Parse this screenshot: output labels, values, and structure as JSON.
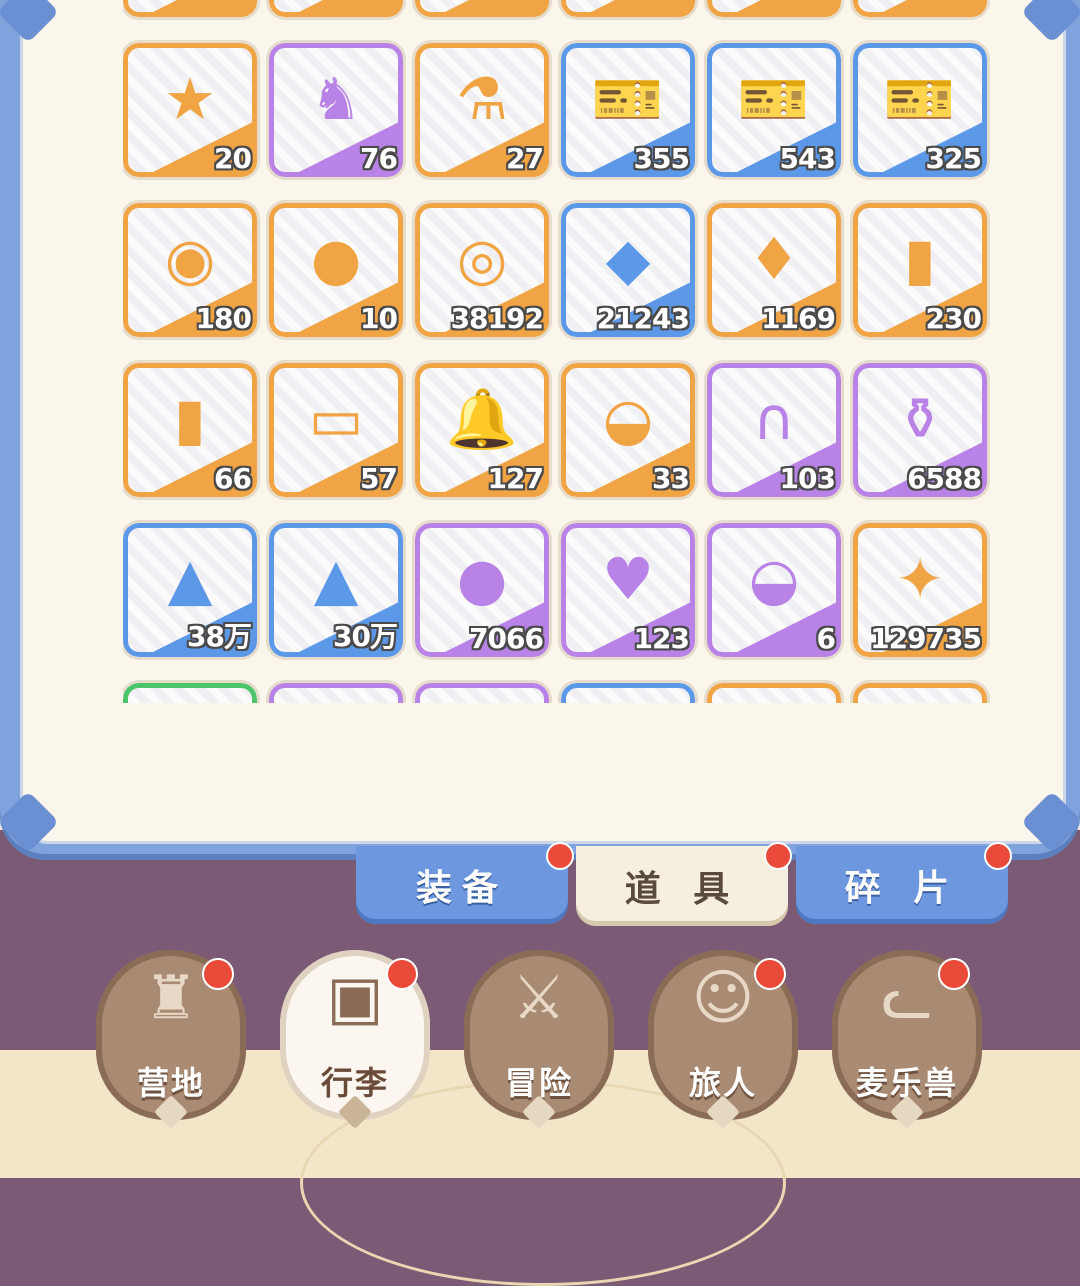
{
  "inventory": {
    "items": [
      {
        "name": "item-partial-1",
        "icon": "",
        "count": "",
        "rarity": "orange"
      },
      {
        "name": "item-partial-2",
        "icon": "",
        "count": "",
        "rarity": "orange"
      },
      {
        "name": "item-partial-3",
        "icon": "",
        "count": "",
        "rarity": "orange"
      },
      {
        "name": "item-partial-4",
        "icon": "",
        "count": "",
        "rarity": "orange"
      },
      {
        "name": "item-partial-5",
        "icon": "",
        "count": "",
        "rarity": "orange"
      },
      {
        "name": "item-partial-6",
        "icon": "",
        "count": "",
        "rarity": "orange"
      },
      {
        "name": "gold-crystal-ore",
        "icon": "gold-crystal-icon",
        "glyph": "★",
        "count": "20",
        "rarity": "orange"
      },
      {
        "name": "seahorse-figurine",
        "icon": "seahorse-icon",
        "glyph": "♞",
        "count": "76",
        "rarity": "purple"
      },
      {
        "name": "blue-potion",
        "icon": "potion-icon",
        "glyph": "⚗",
        "count": "27",
        "rarity": "orange"
      },
      {
        "name": "blue-ticket",
        "icon": "ticket-icon",
        "glyph": "🎫",
        "count": "355",
        "rarity": "blue"
      },
      {
        "name": "purple-ticket",
        "icon": "ticket-icon",
        "glyph": "🎫",
        "count": "543",
        "rarity": "blue"
      },
      {
        "name": "gold-ticket",
        "icon": "ticket-icon",
        "glyph": "🎫",
        "count": "325",
        "rarity": "blue"
      },
      {
        "name": "ornate-bell-ball",
        "icon": "bell-ball-icon",
        "glyph": "◉",
        "count": "180",
        "rarity": "orange"
      },
      {
        "name": "cat-coin",
        "icon": "cat-coin-icon",
        "glyph": "●",
        "count": "10",
        "rarity": "orange"
      },
      {
        "name": "rune-orb",
        "icon": "orb-icon",
        "glyph": "◎",
        "count": "38192",
        "rarity": "orange"
      },
      {
        "name": "blue-gem",
        "icon": "gem-icon",
        "glyph": "◆",
        "count": "21243",
        "rarity": "blue"
      },
      {
        "name": "ice-crystal",
        "icon": "crystal-icon",
        "glyph": "♦",
        "count": "1169",
        "rarity": "orange"
      },
      {
        "name": "rainbow-paint-tube",
        "icon": "paint-tube-icon",
        "glyph": "▮",
        "count": "230",
        "rarity": "orange"
      },
      {
        "name": "rainbow-paint-splash",
        "icon": "paint-bottle-icon",
        "glyph": "▮",
        "count": "66",
        "rarity": "orange"
      },
      {
        "name": "outfit-card",
        "icon": "card-icon",
        "glyph": "▭",
        "count": "57",
        "rarity": "orange"
      },
      {
        "name": "ribbon-bell",
        "icon": "bell-icon",
        "glyph": "🔔",
        "count": "127",
        "rarity": "orange"
      },
      {
        "name": "seed-sack",
        "icon": "sack-icon",
        "glyph": "◒",
        "count": "33",
        "rarity": "orange"
      },
      {
        "name": "golden-horseshoe",
        "icon": "horseshoe-icon",
        "glyph": "∩",
        "count": "103",
        "rarity": "purple"
      },
      {
        "name": "bottled-creature",
        "icon": "bottle-icon",
        "glyph": "⚱",
        "count": "6588",
        "rarity": "purple"
      },
      {
        "name": "blue-pearl-sand",
        "icon": "sand-pile-icon",
        "glyph": "▲",
        "count": "38万",
        "rarity": "blue"
      },
      {
        "name": "purple-pearl-sand",
        "icon": "sand-pile-icon",
        "glyph": "▲",
        "count": "30万",
        "rarity": "blue"
      },
      {
        "name": "paw-cookie",
        "icon": "cookie-icon",
        "glyph": "●",
        "count": "7066",
        "rarity": "purple"
      },
      {
        "name": "cat-spoon",
        "icon": "spoon-icon",
        "glyph": "♥",
        "count": "123",
        "rarity": "purple"
      },
      {
        "name": "paw-flour-sack",
        "icon": "flour-sack-icon",
        "glyph": "◒",
        "count": "6",
        "rarity": "purple"
      },
      {
        "name": "star-crystal",
        "icon": "star-crystal-icon",
        "glyph": "✦",
        "count": "129735",
        "rarity": "orange"
      },
      {
        "name": "item-partial-7",
        "icon": "",
        "count": "",
        "rarity": "green"
      },
      {
        "name": "item-partial-8",
        "icon": "",
        "count": "",
        "rarity": "purple"
      },
      {
        "name": "item-partial-9",
        "icon": "",
        "count": "",
        "rarity": "purple"
      },
      {
        "name": "item-partial-10",
        "icon": "",
        "count": "",
        "rarity": "blue"
      },
      {
        "name": "item-partial-11",
        "icon": "",
        "count": "",
        "rarity": "orange"
      },
      {
        "name": "item-partial-12",
        "icon": "",
        "count": "",
        "rarity": "orange"
      }
    ]
  },
  "rarity_colors": {
    "orange": "#f0a443",
    "purple": "#b982e6",
    "blue": "#5c98e8",
    "green": "#4cc46a"
  },
  "tabs": {
    "equipment": "装备",
    "items": "道 具",
    "fragments": "碎 片",
    "active": "items"
  },
  "nav": {
    "camp": "营地",
    "luggage": "行李",
    "adventure": "冒险",
    "traveler": "旅人",
    "mailers": "麦乐兽",
    "active": "luggage"
  }
}
